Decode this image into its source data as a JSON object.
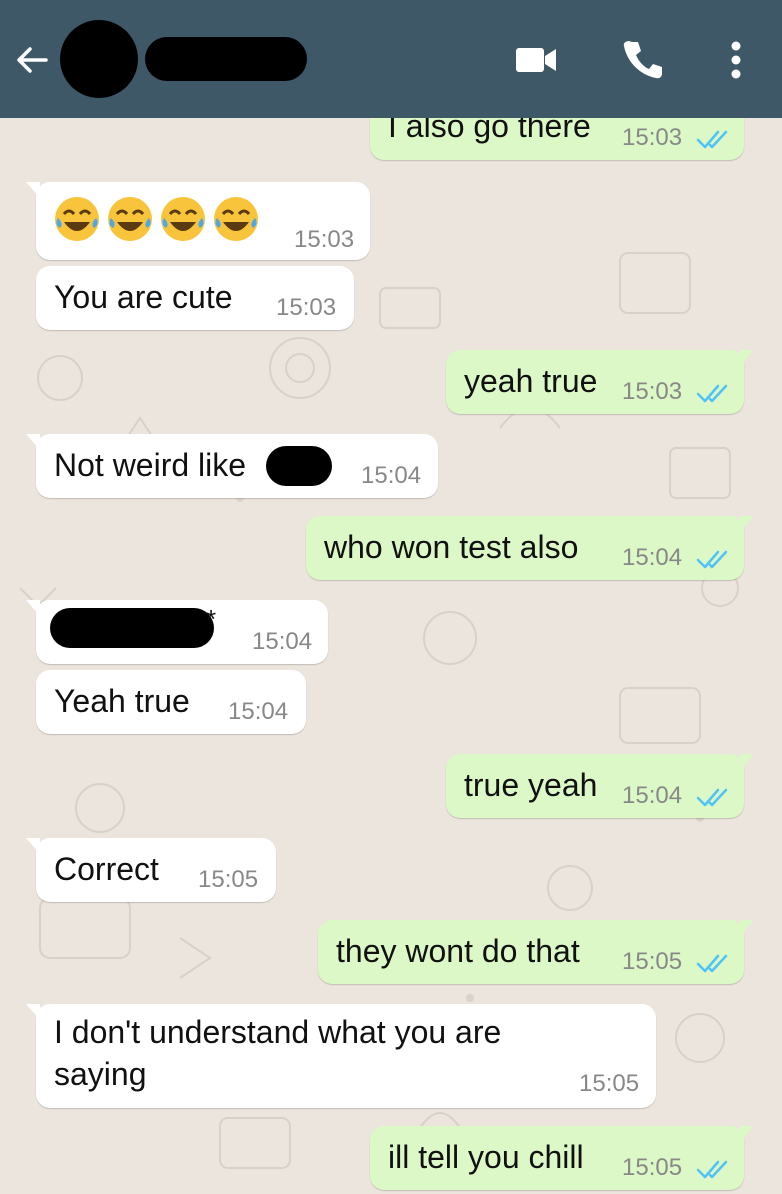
{
  "header": {
    "back_icon": "arrow-left-icon",
    "video_icon": "video-camera-icon",
    "call_icon": "phone-icon",
    "menu_icon": "more-vertical-icon"
  },
  "colors": {
    "header_bg": "#3f5867",
    "chat_bg": "#ece5dd",
    "incoming_bubble": "#ffffff",
    "outgoing_bubble": "#dcf8c6",
    "read_ticks": "#4fc3f7"
  },
  "messages": [
    {
      "dir": "out",
      "text": "I also go there",
      "time": "15:03"
    },
    {
      "dir": "in",
      "text": "",
      "emoji": [
        "face-with-tears-of-joy",
        "face-with-tears-of-joy",
        "face-with-tears-of-joy",
        "face-with-tears-of-joy"
      ],
      "time": "15:03"
    },
    {
      "dir": "in",
      "text": "You are cute",
      "time": "15:03"
    },
    {
      "dir": "out",
      "text": "yeah true",
      "time": "15:03"
    },
    {
      "dir": "in",
      "text": "Not weird like",
      "time": "15:04"
    },
    {
      "dir": "out",
      "text": "who won test also",
      "time": "15:04"
    },
    {
      "dir": "in",
      "text": "*",
      "time": "15:04"
    },
    {
      "dir": "in",
      "text": "Yeah true",
      "time": "15:04"
    },
    {
      "dir": "out",
      "text": "true yeah",
      "time": "15:04"
    },
    {
      "dir": "in",
      "text": "Correct",
      "time": "15:05"
    },
    {
      "dir": "out",
      "text": "they wont do that",
      "time": "15:05"
    },
    {
      "dir": "in",
      "text": "I don't understand what you are saying",
      "line1": "I don't understand what you are",
      "line2": "saying",
      "time": "15:05"
    },
    {
      "dir": "out",
      "text": "ill tell you chill",
      "time": "15:05"
    }
  ]
}
